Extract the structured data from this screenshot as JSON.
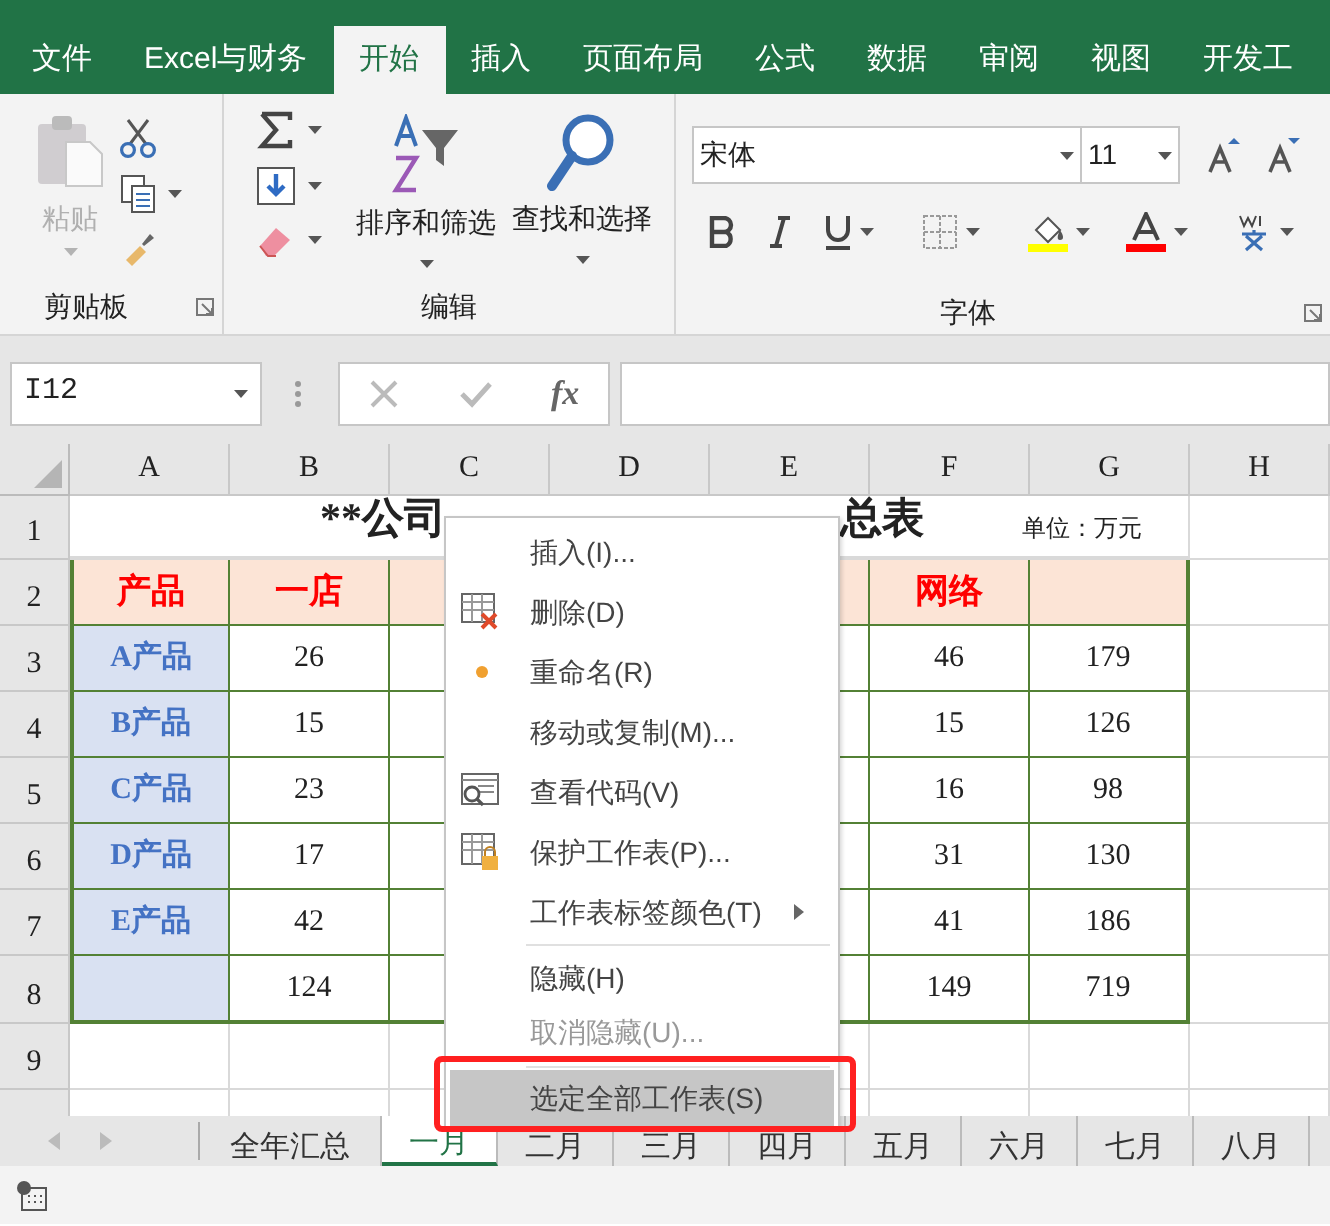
{
  "ribbon_tabs": [
    {
      "label": "文件",
      "selected": false
    },
    {
      "label": "Excel与财务",
      "selected": false
    },
    {
      "label": "开始",
      "selected": true
    },
    {
      "label": "插入",
      "selected": false
    },
    {
      "label": "页面布局",
      "selected": false
    },
    {
      "label": "公式",
      "selected": false
    },
    {
      "label": "数据",
      "selected": false
    },
    {
      "label": "审阅",
      "selected": false
    },
    {
      "label": "视图",
      "selected": false
    },
    {
      "label": "开发工",
      "selected": false
    }
  ],
  "ribbon": {
    "paste": "粘贴",
    "clipboard_group": "剪贴板",
    "sort_filter": "排序和筛选",
    "find_select": "查找和选择",
    "editing_group": "编辑",
    "font_name": "宋体",
    "font_size": "11",
    "font_group": "字体"
  },
  "formula_bar": {
    "name_box": "I12",
    "insert_function": "fx"
  },
  "columns": [
    "A",
    "B",
    "C",
    "D",
    "E",
    "F",
    "G",
    "H"
  ],
  "title_row": {
    "number": "1",
    "title_left": "**公司",
    "title_right": "总表",
    "unit": "单位：万元"
  },
  "rows": [
    {
      "number": "2",
      "kind": "header",
      "cells": {
        "A": "产品",
        "B": "一店",
        "F": "网络"
      }
    },
    {
      "number": "3",
      "kind": "data",
      "cells": {
        "A": "A产品",
        "B": "26",
        "F": "46",
        "G": "179"
      }
    },
    {
      "number": "4",
      "kind": "data",
      "cells": {
        "A": "B产品",
        "B": "15",
        "F": "15",
        "G": "126"
      }
    },
    {
      "number": "5",
      "kind": "data",
      "cells": {
        "A": "C产品",
        "B": "23",
        "F": "16",
        "G": "98"
      }
    },
    {
      "number": "6",
      "kind": "data",
      "cells": {
        "A": "D产品",
        "B": "17",
        "F": "31",
        "G": "130"
      }
    },
    {
      "number": "7",
      "kind": "data",
      "cells": {
        "A": "E产品",
        "B": "42",
        "F": "41",
        "G": "186"
      }
    },
    {
      "number": "8",
      "kind": "data",
      "cells": {
        "B": "124",
        "F": "149",
        "G": "719"
      }
    },
    {
      "number": "9",
      "kind": "empty",
      "cells": {}
    }
  ],
  "context_menu": {
    "items": [
      {
        "kind": "plain",
        "label": "插入(I)...",
        "disabled": false,
        "selected": false
      },
      {
        "kind": "delete",
        "label": "删除(D)",
        "disabled": false,
        "selected": false
      },
      {
        "kind": "marked",
        "label": "重命名(R)",
        "disabled": false,
        "selected": false
      },
      {
        "kind": "plain",
        "label": "移动或复制(M)...",
        "disabled": false,
        "selected": false
      },
      {
        "kind": "code",
        "label": "查看代码(V)",
        "disabled": false,
        "selected": false
      },
      {
        "kind": "protect",
        "label": "保护工作表(P)...",
        "disabled": false,
        "selected": false
      },
      {
        "kind": "cascade",
        "label": "工作表标签颜色(T)",
        "disabled": false,
        "selected": false
      },
      {
        "kind": "separator"
      },
      {
        "kind": "plain",
        "label": "隐藏(H)",
        "disabled": false,
        "selected": false
      },
      {
        "kind": "plain",
        "label": "取消隐藏(U)...",
        "disabled": true,
        "selected": false
      },
      {
        "kind": "separator"
      },
      {
        "kind": "plain",
        "label": "选定全部工作表(S)",
        "disabled": false,
        "selected": true
      }
    ]
  },
  "sheet_tabs": [
    {
      "label": "全年汇总",
      "selected": false
    },
    {
      "label": "一月",
      "selected": true
    },
    {
      "label": "二月",
      "selected": false
    },
    {
      "label": "三月",
      "selected": false
    },
    {
      "label": "四月",
      "selected": false
    },
    {
      "label": "五月",
      "selected": false
    },
    {
      "label": "六月",
      "selected": false
    },
    {
      "label": "七月",
      "selected": false
    },
    {
      "label": "八月",
      "selected": false
    }
  ]
}
